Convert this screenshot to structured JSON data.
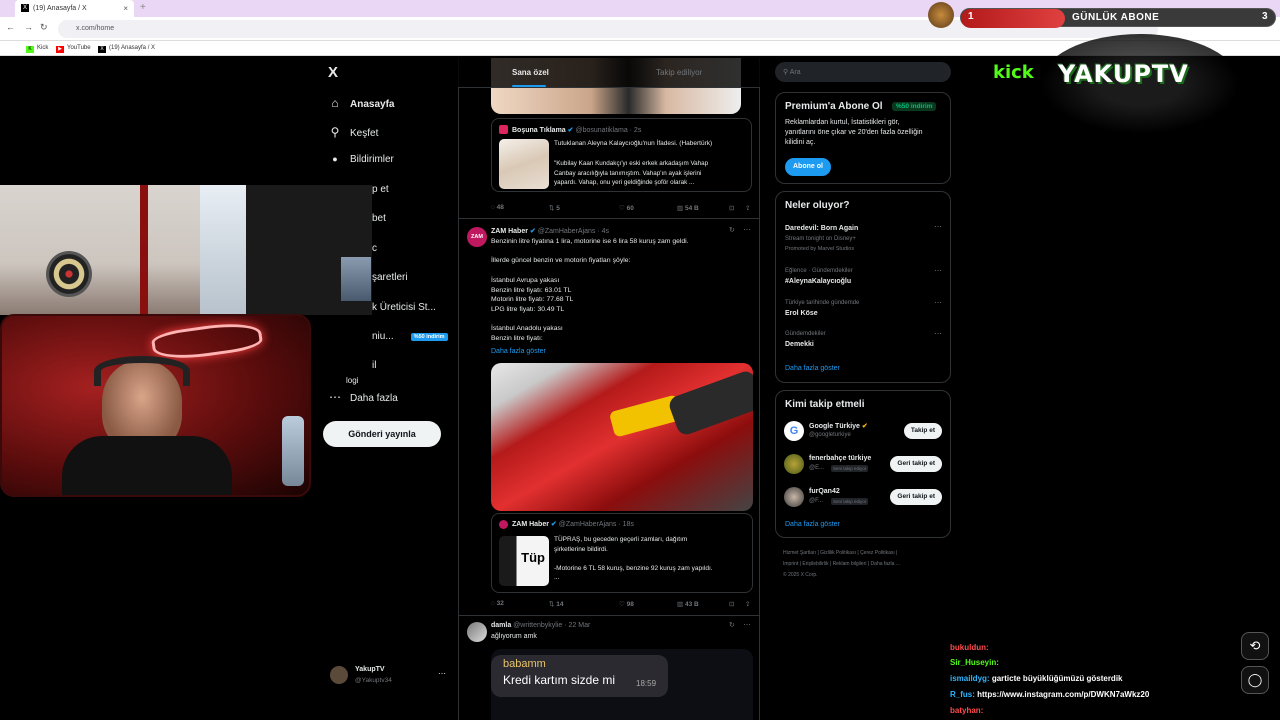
{
  "browser": {
    "tab_title": "(19) Anasayfa / X",
    "tab_close": "×",
    "new_tab": "+",
    "url": "x.com/home",
    "bookmarks": [
      "Kick",
      "YouTube",
      "(19) Anasayfa / X"
    ],
    "back_icon": "←",
    "forward_icon": "→",
    "reload_icon": "↻"
  },
  "x_nav": {
    "logo": "X",
    "items": [
      {
        "icon": "home-icon",
        "glyph": "⌂",
        "label": "Anasayfa"
      },
      {
        "icon": "search-icon",
        "glyph": "⚲",
        "label": "Keşfet"
      },
      {
        "icon": "bell-icon",
        "glyph": "🔔",
        "label": "Bildirimler"
      },
      {
        "icon": "",
        "glyph": "",
        "label": "p et"
      },
      {
        "icon": "",
        "glyph": "",
        "label": "bet"
      },
      {
        "icon": "",
        "glyph": "",
        "label": "c"
      },
      {
        "icon": "",
        "glyph": "",
        "label": "şaretleri"
      },
      {
        "icon": "",
        "glyph": "",
        "label": "k Üreticisi St..."
      },
      {
        "icon": "",
        "glyph": "",
        "label": "niu..."
      },
      {
        "icon": "",
        "glyph": "",
        "label": "il"
      },
      {
        "icon": "",
        "glyph": "",
        "label": "logi"
      },
      {
        "icon": "more-icon",
        "glyph": "⋯",
        "label": "Daha fazla"
      }
    ],
    "premium_badge": "%50 indirim",
    "post_button": "Gönderi yayınla",
    "account": {
      "name": "YakupTV",
      "handle": "@Yakuptv34",
      "more": "⋯"
    }
  },
  "feed": {
    "tabs": [
      "Sana özel",
      "Takip ediliyor"
    ],
    "tweet1": {
      "quote_author": "Boşuna Tıklama",
      "quote_handle": "@bosunatiklama · 2s",
      "quote_title": "Tutuklanan Aleyna Kalaycıoğlu'nun İfadesi. (Habertürk)",
      "quote_body": "\"Kubilay Kaan Kundakçı'yı eski erkek arkadaşım Vahap\nCanbay aracılığıyla tanımıştım. Vahap'ın ayak işlerini\nyapardı. Vahap, onu yeri geldiğinde şoför olarak ...",
      "stats": [
        "48",
        "5",
        "60",
        "54 B"
      ]
    },
    "tweet2": {
      "author": "ZAM Haber",
      "handle": "@ZamHaberAjans · 4s",
      "avatar_text": "ZAM",
      "text": "Benzinin litre fiyatına 1 lira, motorine ise 6 lira 58 kuruş zam geldi.\n\nİllerde güncel benzin ve motorin fiyatları şöyle:\n\nİstanbul Avrupa yakası\nBenzin litre fiyatı: 63.01 TL\nMotorin litre fiyatı: 77.68 TL\nLPG litre fiyatı: 30.49 TL\n\nİstanbul Anadolu yakası\nBenzin litre fiyatı:",
      "show_more": "Daha fazla göster",
      "quote_author": "ZAM Haber",
      "quote_handle": "@ZamHaberAjans · 18s",
      "quote_body": "TÜPRAŞ, bu geceden geçerli zamları, dağıtım\nşirketlerine bildirdi.\n\n-Motorine 6 TL 58 kuruş, benzine 92 kuruş zam yapıldı.\n...",
      "quote_thumb": "Tüp",
      "stats": [
        "32",
        "14",
        "98",
        "43 B"
      ]
    },
    "tweet3": {
      "author": "damla",
      "handle": "@writtenbykylie · 22 Mar",
      "text": "ağlıyorum amk",
      "chat_sender": "babamm",
      "chat_message": "Kredi kartım sizde mi",
      "chat_time": "18:59"
    }
  },
  "sidebar": {
    "search_placeholder": "Ara",
    "premium": {
      "title": "Premium'a Abone Ol",
      "badge": "%50 indirim",
      "body": "Reklamlardan kurtul, İstatistikleri gör,\nyanıtlarını öne çıkar ve 20'den fazla özelliğin\nkilidini aç.",
      "button": "Abone ol"
    },
    "trends": {
      "title": "Neler oluyor?",
      "items": [
        {
          "category": "",
          "name": "Daredevil: Born Again",
          "sub": "Stream tonight on Disney+",
          "promo": "Promoted by Marvel Studios"
        },
        {
          "category": "Eğlence · Gündemdekiler",
          "name": "#AleynaKalaycıoğlu",
          "sub": "",
          "promo": ""
        },
        {
          "category": "Türkiye tarihinde gündemde",
          "name": "Erol Köse",
          "sub": "",
          "promo": ""
        },
        {
          "category": "Gündemdekiler",
          "name": "Demekki",
          "sub": "",
          "promo": ""
        }
      ],
      "show_more": "Daha fazla göster"
    },
    "who_to_follow": {
      "title": "Kimi takip etmeli",
      "items": [
        {
          "name": "Google Türkiye",
          "handle": "@googleturkiye",
          "button": "Takip et",
          "tag": ""
        },
        {
          "name": "fenerbahçe türkiye",
          "handle": "@E...",
          "button": "Geri takip et",
          "tag": "Seni takip ediyor"
        },
        {
          "name": "furQan42",
          "handle": "@F...",
          "button": "Geri takip et",
          "tag": "Seni takip ediyor"
        }
      ],
      "show_more": "Daha fazla göster"
    },
    "footer": [
      "Hizmet Şartları",
      "Gizlilik Politikası",
      "Çerez Politikası",
      "Imprint",
      "Erişilebilirlik",
      "Reklam bilgileri",
      "Daha fazla ...",
      "© 2025 X Corp."
    ]
  },
  "stream": {
    "goal": {
      "start": "1",
      "label": "GÜNLÜK ABONE",
      "end": "3",
      "progress": 0.33
    },
    "kick_logo": "kick",
    "channel_logo": "YAKUPTV",
    "chat": [
      {
        "user": "bukuldun:",
        "message": "",
        "color": "#ff4b4b"
      },
      {
        "user": "Sir_Huseyin:",
        "message": "",
        "color": "#53fc18"
      },
      {
        "user": "ismaildyg:",
        "message": "garticte büyüklüğümüzü gösterdik",
        "color": "#2fb6ff"
      },
      {
        "user": "R_fus:",
        "message": "https://www.instagram.com/p/DWKN7aWkz20",
        "color": "#2fb6ff"
      },
      {
        "user": "batyhan:",
        "message": "",
        "color": "#ff4b4b"
      }
    ]
  },
  "colors": {
    "accent": "#1d9bf0",
    "kick_green": "#53fc18",
    "goal_red": "#c02020"
  }
}
